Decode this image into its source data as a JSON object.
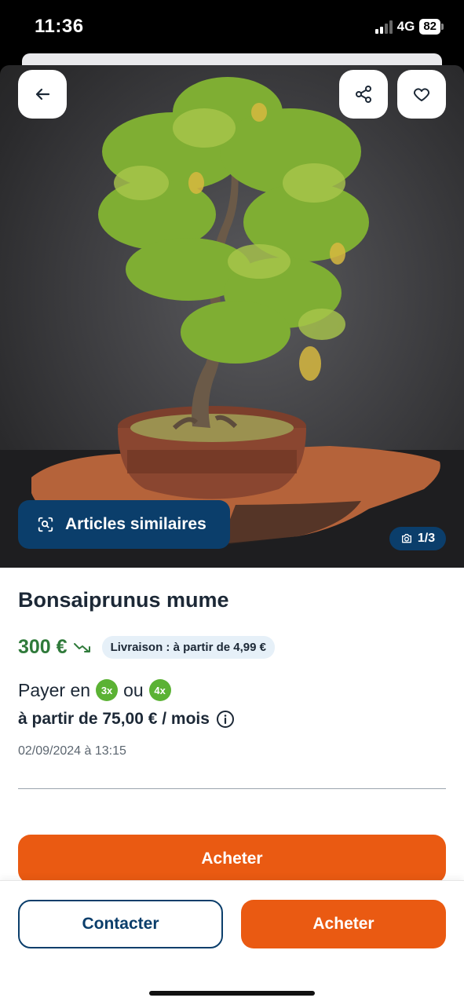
{
  "status_bar": {
    "time": "11:36",
    "network": "4G",
    "battery": "82"
  },
  "gallery": {
    "similar_label": "Articles similaires",
    "counter": "1/3"
  },
  "product": {
    "title": "Bonsaiprunus mume",
    "price": "300 €",
    "delivery": "Livraison : à partir de 4,99 €",
    "pay_prefix": "Payer en",
    "pay_option_1": "3x",
    "pay_or": "ou",
    "pay_option_2": "4x",
    "monthly": "à partir de 75,00 € / mois",
    "date": "02/09/2024 à 13:15"
  },
  "actions": {
    "buy_main": "Acheter",
    "contact": "Contacter",
    "buy": "Acheter"
  },
  "icons": {
    "back": "arrow-left-icon",
    "share": "share-icon",
    "favorite": "heart-icon",
    "similar": "visual-search-icon",
    "camera": "camera-icon",
    "price_drop": "trend-down-icon",
    "info": "info-icon"
  },
  "colors": {
    "brand_blue": "#0b3e6b",
    "accent_orange": "#ea5a12",
    "price_green": "#2f7a3a",
    "badge_green": "#5bb234"
  }
}
